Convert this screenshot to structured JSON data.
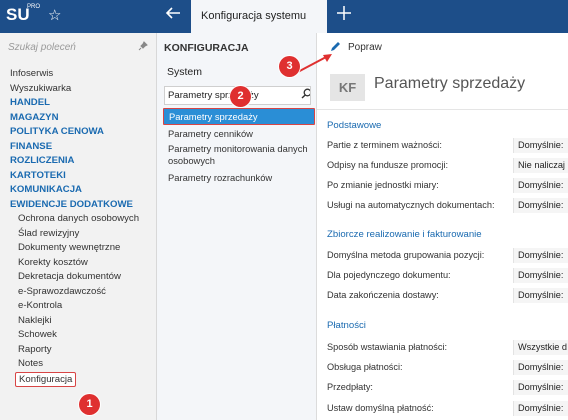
{
  "app": {
    "logo": "SU",
    "logo_sup": "PRO",
    "active_tab": "Konfiguracja systemu"
  },
  "sidebar": {
    "search_placeholder": "Szukaj poleceń",
    "items": [
      {
        "label": "Infoserwis",
        "kind": "plain"
      },
      {
        "label": "Wyszukiwarka",
        "kind": "plain"
      },
      {
        "label": "HANDEL",
        "kind": "section"
      },
      {
        "label": "MAGAZYN",
        "kind": "section"
      },
      {
        "label": "POLITYKA CENOWA",
        "kind": "section"
      },
      {
        "label": "FINANSE",
        "kind": "section"
      },
      {
        "label": "ROZLICZENIA",
        "kind": "section"
      },
      {
        "label": "KARTOTEKI",
        "kind": "section"
      },
      {
        "label": "KOMUNIKACJA",
        "kind": "section"
      },
      {
        "label": "EWIDENCJE DODATKOWE",
        "kind": "section"
      },
      {
        "label": "Ochrona danych osobowych",
        "kind": "sub"
      },
      {
        "label": "Ślad rewizyjny",
        "kind": "sub"
      },
      {
        "label": "Dokumenty wewnętrzne",
        "kind": "sub"
      },
      {
        "label": "Korekty kosztów",
        "kind": "sub"
      },
      {
        "label": "Dekretacja dokumentów",
        "kind": "sub"
      },
      {
        "label": "e-Sprawozdawczość",
        "kind": "sub"
      },
      {
        "label": "e-Kontrola",
        "kind": "sub"
      },
      {
        "label": "Naklejki",
        "kind": "sub"
      },
      {
        "label": "Schowek",
        "kind": "sub"
      },
      {
        "label": "Raporty",
        "kind": "sub"
      },
      {
        "label": "Notes",
        "kind": "sub"
      },
      {
        "label": "Konfiguracja",
        "kind": "selected"
      }
    ]
  },
  "config_panel": {
    "title": "KONFIGURACJA",
    "system_label": "System",
    "search_value": "Parametry sprzedaży",
    "items": [
      "Parametry sprzedaży",
      "Parametry cenników",
      "Parametry monitorowania danych osobowych",
      "Parametry rozrachunków"
    ]
  },
  "main": {
    "toolbar_button": "Popraw",
    "kf": "KF",
    "title": "Parametry sprzedaży",
    "groups": [
      {
        "name": "Podstawowe",
        "rows": [
          {
            "label": "Partie z terminem ważności:",
            "value": "Domyślnie:"
          },
          {
            "label": "Odpisy na fundusze promocji:",
            "value": "Nie naliczaj"
          },
          {
            "label": "Po zmianie jednostki miary:",
            "value": "Domyślnie:"
          },
          {
            "label": "Usługi na automatycznych dokumentach:",
            "value": "Domyślnie:"
          }
        ]
      },
      {
        "name": "Zbiorcze realizowanie i fakturowanie",
        "rows": [
          {
            "label": "Domyślna metoda grupowania pozycji:",
            "value": "Domyślnie:"
          },
          {
            "label": "Dla pojedynczego dokumentu:",
            "value": "Domyślnie:"
          },
          {
            "label": "Data zakończenia dostawy:",
            "value": "Domyślnie:"
          }
        ]
      },
      {
        "name": "Płatności",
        "rows": [
          {
            "label": "Sposób wstawiania płatności:",
            "value": "Wszystkie d"
          },
          {
            "label": "Obsługa płatności:",
            "value": "Domyślnie:"
          },
          {
            "label": "Przedpłaty:",
            "value": "Domyślnie:"
          },
          {
            "label": "Ustaw domyślną płatność:",
            "value": "Domyślnie:"
          }
        ]
      }
    ]
  },
  "callouts": [
    "1",
    "2",
    "3"
  ],
  "colors": {
    "topbar": "#1d4e89",
    "accent": "#1a6ab0",
    "selection": "#2a8ed6",
    "callout": "#df3030"
  }
}
